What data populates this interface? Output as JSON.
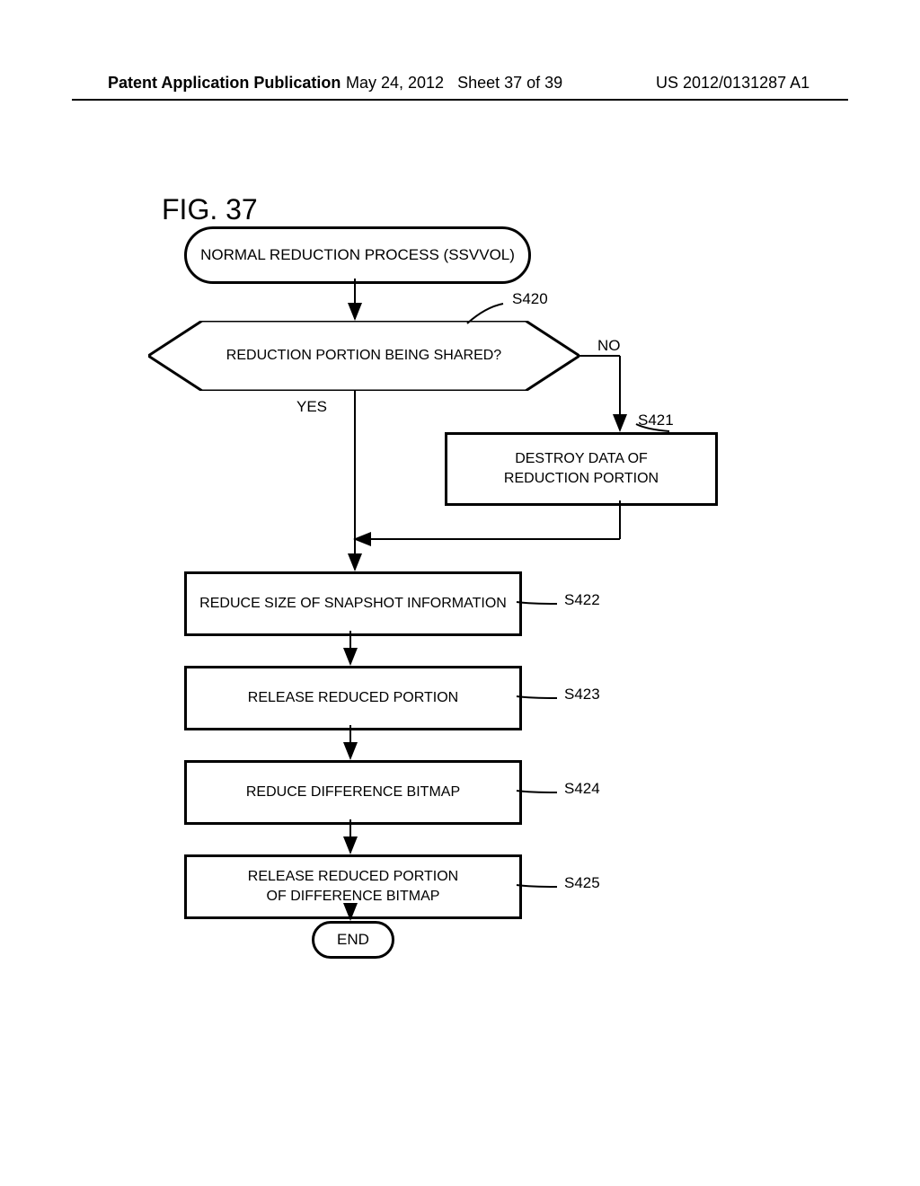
{
  "header": {
    "left": "Patent Application Publication",
    "date": "May 24, 2012",
    "sheet": "Sheet 37 of 39",
    "pubno": "US 2012/0131287 A1"
  },
  "figure_label": "FIG. 37",
  "start": "NORMAL REDUCTION PROCESS (SSVVOL)",
  "decision": {
    "text": "REDUCTION PORTION BEING SHARED?",
    "yes": "YES",
    "no": "NO",
    "step": "S420"
  },
  "destroy": {
    "text": "DESTROY DATA OF\nREDUCTION PORTION",
    "step": "S421"
  },
  "s422": {
    "text": "REDUCE SIZE OF SNAPSHOT INFORMATION",
    "step": "S422"
  },
  "s423": {
    "text": "RELEASE REDUCED PORTION",
    "step": "S423"
  },
  "s424": {
    "text": "REDUCE DIFFERENCE BITMAP",
    "step": "S424"
  },
  "s425": {
    "text": "RELEASE REDUCED PORTION\nOF DIFFERENCE BITMAP",
    "step": "S425"
  },
  "end": "END"
}
